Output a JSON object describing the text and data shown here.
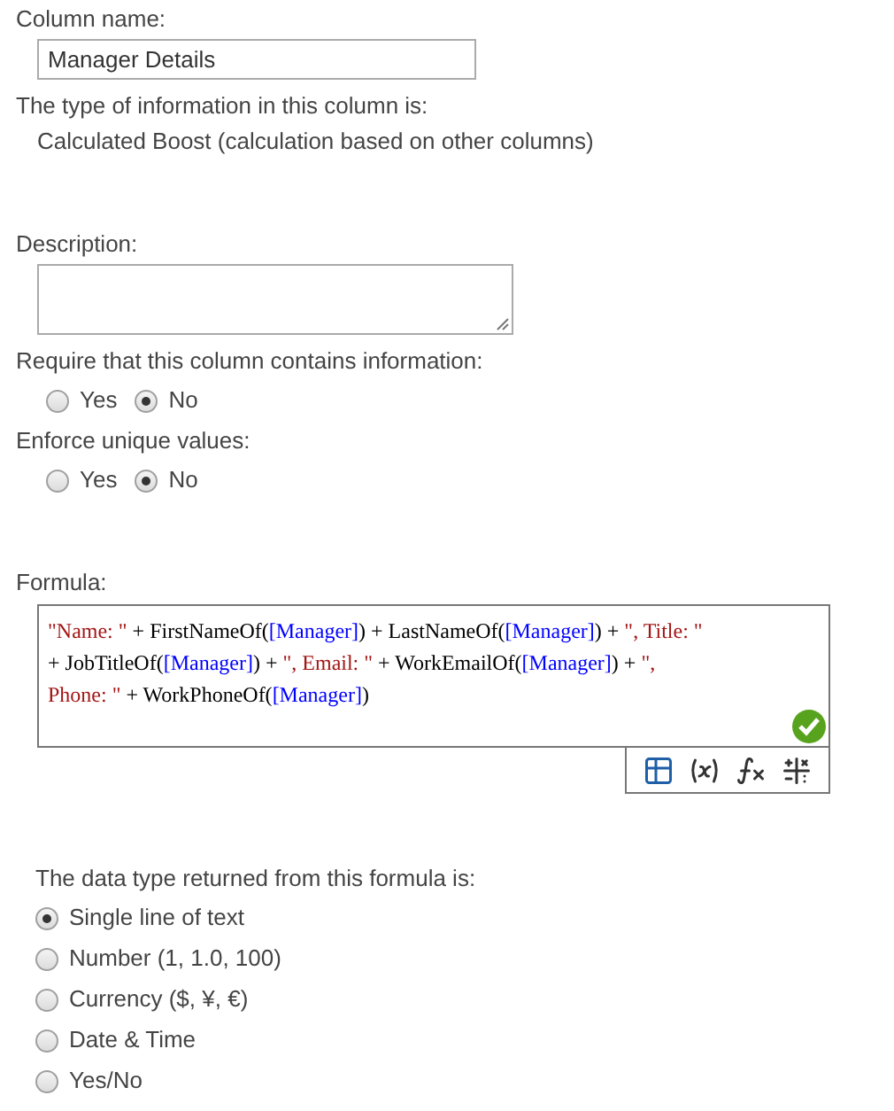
{
  "column_name": {
    "label": "Column name:",
    "value": "Manager Details"
  },
  "type_info": {
    "label": "The type of information in this column is:",
    "value": "Calculated Boost (calculation based on other columns)"
  },
  "description": {
    "label": "Description:"
  },
  "require": {
    "label": "Require that this column contains information:",
    "options": [
      {
        "label": "Yes",
        "selected": false
      },
      {
        "label": "No",
        "selected": true
      }
    ]
  },
  "unique": {
    "label": "Enforce unique values:",
    "options": [
      {
        "label": "Yes",
        "selected": false
      },
      {
        "label": "No",
        "selected": true
      }
    ]
  },
  "formula": {
    "label": "Formula:",
    "valid": true,
    "lines": [
      [
        {
          "kind": "string",
          "text": "\"Name: \""
        },
        {
          "kind": "plain",
          "text": " + FirstNameOf("
        },
        {
          "kind": "field",
          "text": "[Manager]"
        },
        {
          "kind": "plain",
          "text": ") + LastNameOf("
        },
        {
          "kind": "field",
          "text": "[Manager]"
        },
        {
          "kind": "plain",
          "text": ") + "
        },
        {
          "kind": "string",
          "text": "\", Title: \""
        }
      ],
      [
        {
          "kind": "plain",
          "text": "+ JobTitleOf("
        },
        {
          "kind": "field",
          "text": "[Manager]"
        },
        {
          "kind": "plain",
          "text": ") + "
        },
        {
          "kind": "string",
          "text": "\", Email: \""
        },
        {
          "kind": "plain",
          "text": " + WorkEmailOf("
        },
        {
          "kind": "field",
          "text": "[Manager]"
        },
        {
          "kind": "plain",
          "text": ") + "
        },
        {
          "kind": "string",
          "text": "\","
        }
      ],
      [
        {
          "kind": "string",
          "text": "Phone: \""
        },
        {
          "kind": "plain",
          "text": " + WorkPhoneOf("
        },
        {
          "kind": "field",
          "text": "[Manager]"
        },
        {
          "kind": "plain",
          "text": ")"
        }
      ]
    ]
  },
  "return_type": {
    "label": "The data type returned from this formula is:",
    "options": [
      {
        "label": "Single line of text",
        "selected": true
      },
      {
        "label": "Number (1, 1.0, 100)",
        "selected": false
      },
      {
        "label": "Currency ($, ¥, €)",
        "selected": false
      },
      {
        "label": "Date & Time",
        "selected": false
      },
      {
        "label": "Yes/No",
        "selected": false
      }
    ]
  }
}
